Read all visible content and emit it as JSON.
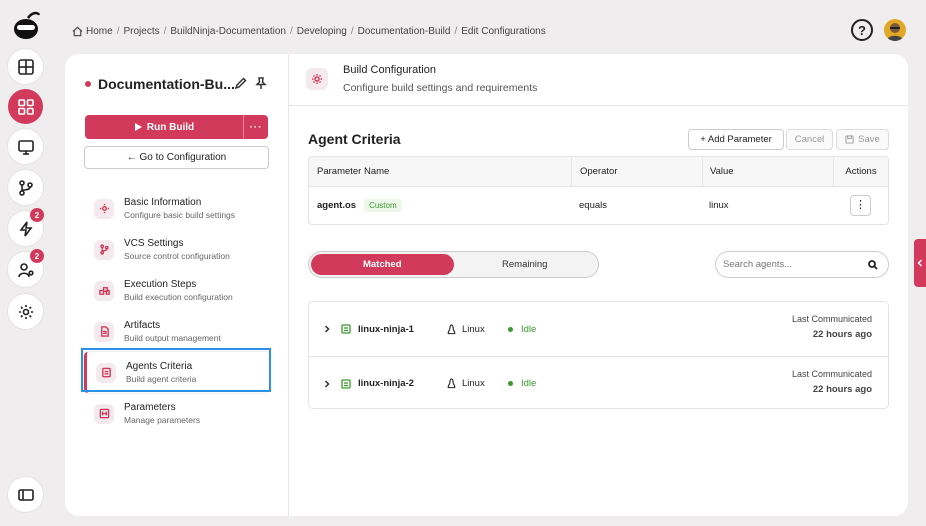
{
  "breadcrumb": [
    "Home",
    "Projects",
    "BuildNinja-Documentation",
    "Developing",
    "Documentation-Build",
    "Edit Configurations"
  ],
  "help_label": "?",
  "sidebar_badges": {
    "builds": "2",
    "users": "2"
  },
  "project": {
    "title": "Documentation-Bu..."
  },
  "run_build": {
    "label": "Run Build",
    "more": "···"
  },
  "goto_config": "← Go to Configuration",
  "nav": [
    {
      "title": "Basic Information",
      "subtitle": "Configure basic build settings",
      "icon": "gear-icon"
    },
    {
      "title": "VCS Settings",
      "subtitle": "Source control configuration",
      "icon": "branch-icon"
    },
    {
      "title": "Execution Steps",
      "subtitle": "Build execution configuration",
      "icon": "steps-icon"
    },
    {
      "title": "Artifacts",
      "subtitle": "Build output management",
      "icon": "file-icon"
    },
    {
      "title": "Agents Criteria",
      "subtitle": "Build agent criteria",
      "icon": "agent-icon"
    },
    {
      "title": "Parameters",
      "subtitle": "Manage parameters",
      "icon": "params-icon"
    }
  ],
  "header": {
    "title": "Build Configuration",
    "subtitle": "Configure build settings and requirements"
  },
  "criteria": {
    "title": "Agent Criteria",
    "add": "+ Add Parameter",
    "cancel": "Cancel",
    "save": "Save",
    "columns": [
      "Parameter Name",
      "Operator",
      "Value",
      "Actions"
    ],
    "rows": [
      {
        "name": "agent.os",
        "tag": "Custom",
        "operator": "equals",
        "value": "linux",
        "action": "⋮"
      }
    ]
  },
  "tabs": {
    "matched": "Matched",
    "remaining": "Remaining"
  },
  "search": {
    "placeholder": "Search agents..."
  },
  "agents": [
    {
      "name": "linux-ninja-1",
      "os": "Linux",
      "status": "Idle",
      "last_label": "Last Communicated",
      "last_value": "22 hours ago"
    },
    {
      "name": "linux-ninja-2",
      "os": "Linux",
      "status": "Idle",
      "last_label": "Last Communicated",
      "last_value": "22 hours ago"
    }
  ],
  "colors": {
    "accent": "#d23a5b",
    "idle": "#3a9a2e",
    "highlight": "#2e8fe6"
  }
}
